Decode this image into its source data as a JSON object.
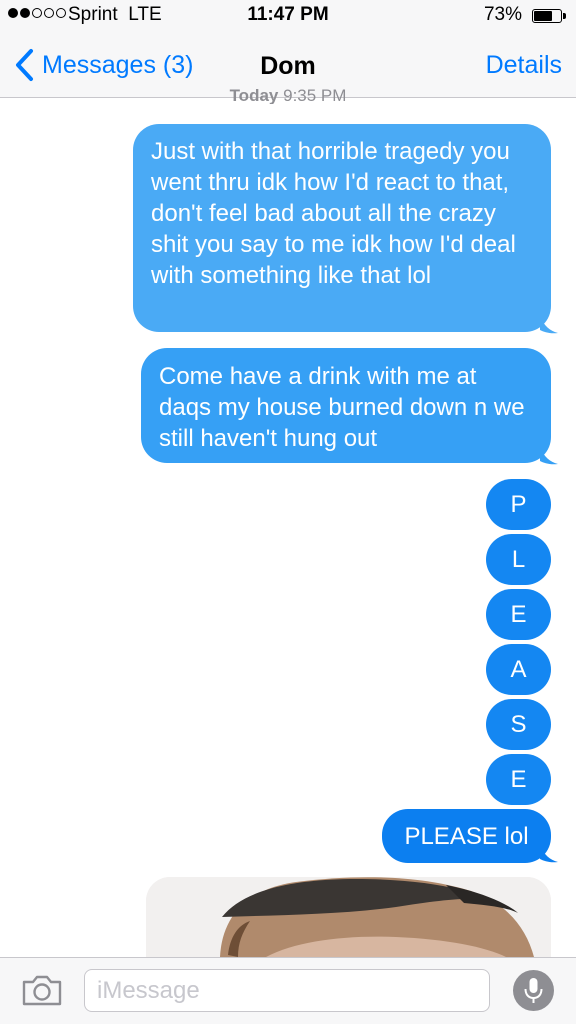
{
  "status_bar": {
    "signal_bars_total": 5,
    "signal_bars_filled": 2,
    "carrier": "Sprint",
    "network": "LTE",
    "time": "11:47 PM",
    "battery_text": "73%",
    "battery_level": 0.73
  },
  "nav": {
    "back_label": "Messages (3)",
    "title": "Dom",
    "details_label": "Details"
  },
  "conversation": {
    "timestamp_day": "Today",
    "timestamp_time": "9:35 PM",
    "messages": [
      {
        "text": "Just with that horrible tragedy you went thru idk how I'd react to that, don't feel bad about all the crazy shit you say to me idk how I'd deal with something like that lol"
      },
      {
        "text": "Come have a drink with me at daqs my house burned down n we still haven't hung out"
      }
    ],
    "letters": [
      "P",
      "L",
      "E",
      "A",
      "S",
      "E"
    ],
    "last_message": "PLEASE lol"
  },
  "input": {
    "placeholder": "iMessage"
  },
  "colors": {
    "ios_blue": "#007aff",
    "bubble_blue": "#1b8df5",
    "bar_gray": "#f7f7f8"
  }
}
